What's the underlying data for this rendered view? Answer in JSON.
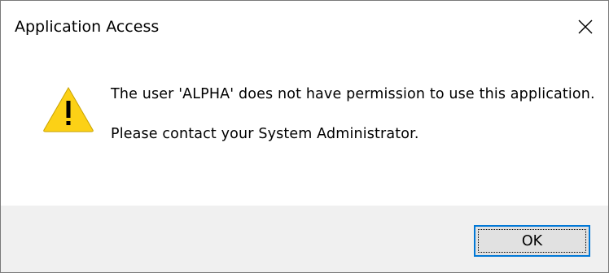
{
  "dialog": {
    "title": "Application Access",
    "close_icon": "close-icon",
    "message_line1": "The user 'ALPHA' does not have permission to use this application.",
    "message_line2": "Please contact your System Administrator.",
    "icon": "warning-icon",
    "ok_label": "OK"
  },
  "colors": {
    "footer_bg": "#f0f0f0",
    "button_border_focus": "#0078d7",
    "button_bg": "#e1e1e1",
    "warning_yellow": "#fcd116"
  }
}
